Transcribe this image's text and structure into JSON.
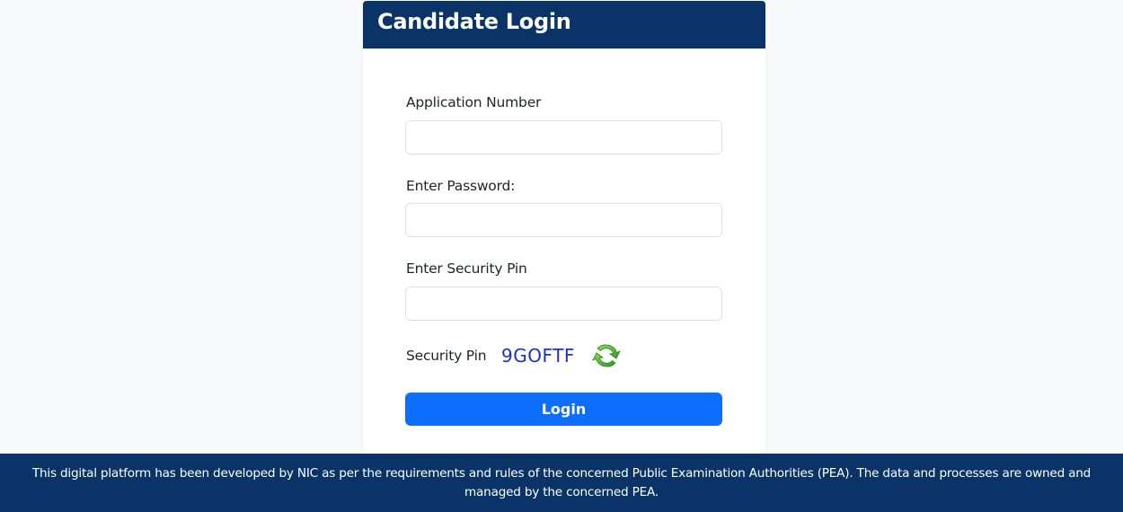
{
  "login_card": {
    "title": "Candidate Login",
    "application_number": {
      "label": "Application Number",
      "value": "",
      "placeholder": ""
    },
    "password": {
      "label": "Enter Password:",
      "value": "",
      "placeholder": ""
    },
    "security_pin": {
      "label": "Enter Security Pin",
      "value": "",
      "placeholder": ""
    },
    "captcha": {
      "label": "Security Pin",
      "code": "9GOFTF",
      "refresh_icon": "refresh-icon"
    },
    "login_button": "Login"
  },
  "footer": {
    "text": "This digital platform has been developed by NIC as per the requirements and rules of the concerned Public Examination Authorities (PEA). The data and processes are owned and managed by the concerned PEA."
  },
  "colors": {
    "header_bg": "#0a3467",
    "footer_bg": "#0a3467",
    "primary_button": "#0d6efd",
    "captcha_text": "#1c2fc9",
    "refresh_icon": "#5cc23a"
  }
}
